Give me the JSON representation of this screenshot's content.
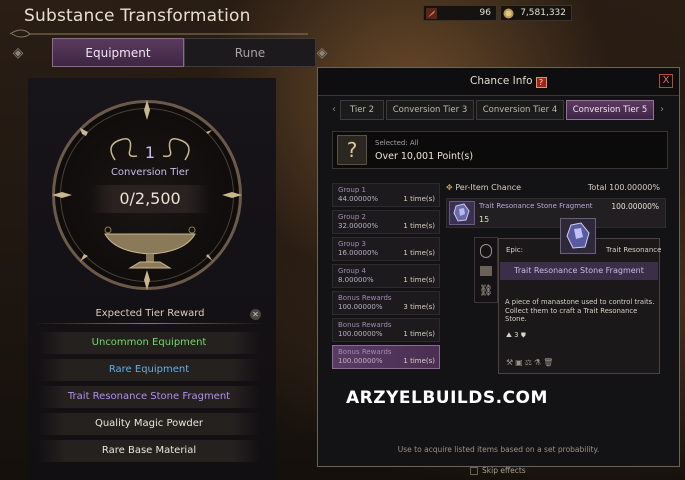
{
  "window_title": "Substance Transformation",
  "currency": [
    {
      "value": "96",
      "icon": "feather-icon"
    },
    {
      "value": "7,581,332",
      "icon": "coin-icon"
    }
  ],
  "tabs": [
    {
      "label": "Equipment"
    },
    {
      "label": "Rune"
    }
  ],
  "tier": {
    "number": "1",
    "label": "Conversion Tier",
    "progress": "0/2,500"
  },
  "expected_reward": {
    "title": "Expected Tier Reward",
    "items": [
      {
        "label": "Uncommon Equipment",
        "color": "#72d96a"
      },
      {
        "label": "Rare Equipment",
        "color": "#5fb0f0"
      },
      {
        "label": "Trait Resonance Stone Fragment",
        "color": "#b48ef0"
      },
      {
        "label": "Quality Magic Powder",
        "color": "#ece6da"
      },
      {
        "label": "Rare Base Material",
        "color": "#ece6da"
      }
    ]
  },
  "chance": {
    "title": "Chance Info",
    "help": "?",
    "close": "X",
    "tabs": [
      {
        "label": "Tier 2"
      },
      {
        "label": "Conversion Tier 3"
      },
      {
        "label": "Conversion Tier 4"
      },
      {
        "label": "Conversion Tier 5"
      }
    ],
    "selected": {
      "icon_glyph": "?",
      "label": "Selected: All",
      "value": "Over 10,001 Point(s)"
    },
    "groups": [
      {
        "name": "Group 1",
        "pct": "44.00000%",
        "times": "1 time(s)"
      },
      {
        "name": "Group 2",
        "pct": "32.00000%",
        "times": "1 time(s)"
      },
      {
        "name": "Group 3",
        "pct": "16.00000%",
        "times": "1 time(s)"
      },
      {
        "name": "Group 4",
        "pct": "8.00000%",
        "times": "1 time(s)"
      },
      {
        "name": "Bonus Rewards",
        "pct": "100.00000%",
        "times": "3 time(s)"
      },
      {
        "name": "Bonus Rewards",
        "pct": "100.00000%",
        "times": "1 time(s)"
      },
      {
        "name": "Bonus Rewards",
        "pct": "100.00000%",
        "times": "1 time(s)"
      }
    ],
    "per_item": {
      "label": "Per-Item Chance",
      "total": "Total 100.00000%"
    },
    "item": {
      "name": "Trait Resonance Stone Fragment",
      "pct": "100.00000%",
      "qty": "15"
    },
    "footer": "Use to acquire listed items based on a set probability."
  },
  "tooltip": {
    "grade": "Epic",
    "type": "Trait Resonance",
    "name": "Trait Resonance Stone Fragment",
    "description": "A piece of manastone used to control traits. Collect them to craft a Trait Resonance Stone.",
    "stack": "3"
  },
  "watermark": "ARZYELBUILDS.COM",
  "skip_effects": "Skip effects"
}
